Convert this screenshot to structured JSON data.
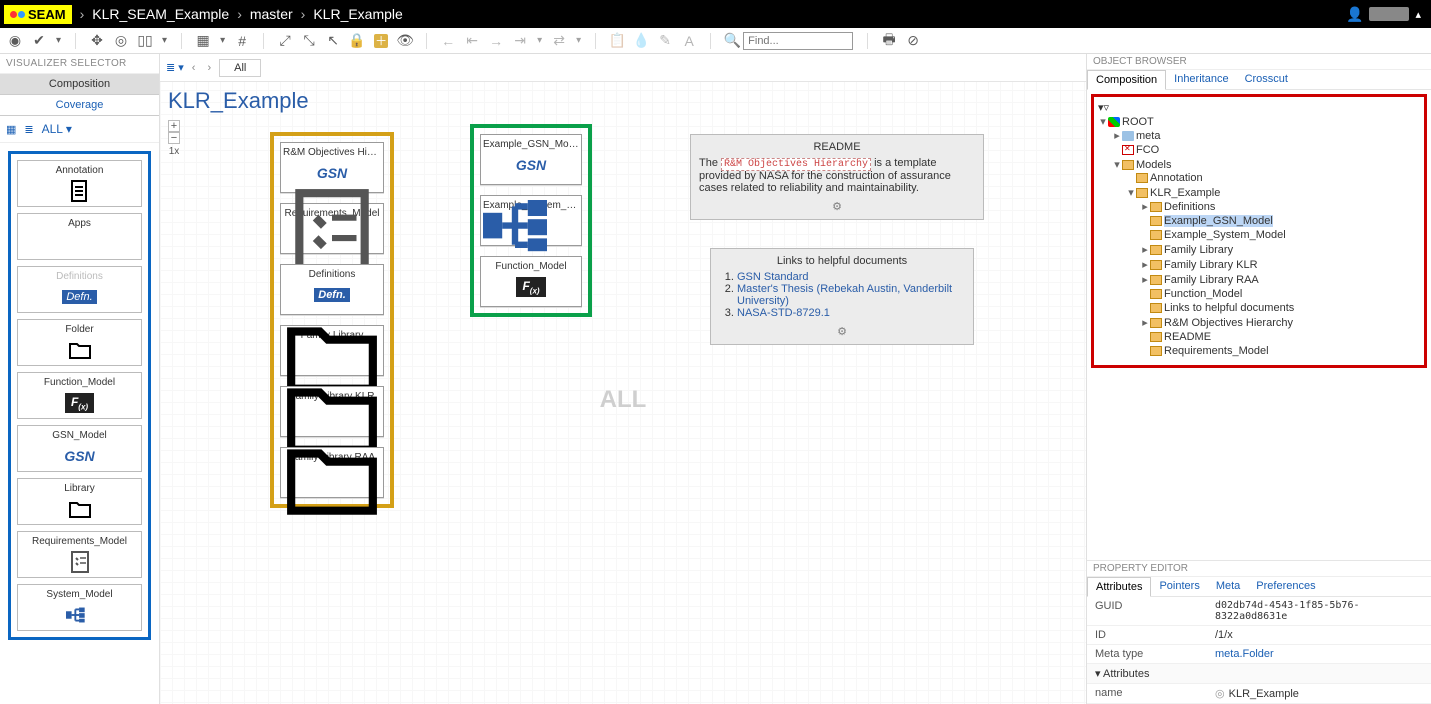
{
  "topbar": {
    "brand": "SEAM",
    "breadcrumb": [
      "KLR_SEAM_Example",
      "master",
      "KLR_Example"
    ]
  },
  "toolbar": {
    "search_placeholder": "Find..."
  },
  "left": {
    "title": "VISUALIZER SELECTOR",
    "tab_composition": "Composition",
    "tab_coverage": "Coverage",
    "all_label": "ALL",
    "palette": [
      {
        "label": "Annotation",
        "kind": "doc"
      },
      {
        "label": "Apps",
        "kind": "none"
      },
      {
        "label": "Definitions",
        "kind": "defn",
        "disabled": true
      },
      {
        "label": "Folder",
        "kind": "folder"
      },
      {
        "label": "Function_Model",
        "kind": "fx"
      },
      {
        "label": "GSN_Model",
        "kind": "gsn"
      },
      {
        "label": "Library",
        "kind": "folder"
      },
      {
        "label": "Requirements_Model",
        "kind": "req"
      },
      {
        "label": "System_Model",
        "kind": "sys"
      }
    ]
  },
  "canvas": {
    "tab_all": "All",
    "title": "KLR_Example",
    "zoom": "1x",
    "watermark": "ALL",
    "yellow_group": [
      {
        "label": "R&M Objectives Hier...",
        "body": "GSN",
        "style": "gsn"
      },
      {
        "label": "Requirements_Model",
        "body": "",
        "style": "req"
      },
      {
        "label": "Definitions",
        "body": "Defn.",
        "style": "defn"
      },
      {
        "label": "Family Library",
        "body": "",
        "style": "folder"
      },
      {
        "label": "Family Library KLR",
        "body": "",
        "style": "folder"
      },
      {
        "label": "Family Library RAA",
        "body": "",
        "style": "folder"
      }
    ],
    "green_group": [
      {
        "label": "Example_GSN_Model",
        "body": "GSN",
        "style": "gsn"
      },
      {
        "label": "Example_System_M...",
        "body": "",
        "style": "sys"
      },
      {
        "label": "Function_Model",
        "body": "F(x)",
        "style": "fx"
      }
    ],
    "readme": {
      "head": "README",
      "pre": "The ",
      "code": "R&M Objectives Hierarchy",
      "post": " is a template provided by NASA for the construction of assurance cases related to reliability and maintainability."
    },
    "links": {
      "head": "Links to helpful documents",
      "items": [
        "GSN Standard",
        "Master's Thesis (Rebekah Austin, Vanderbilt University)",
        "NASA-STD-8729.1"
      ]
    }
  },
  "browser": {
    "title": "OBJECT BROWSER",
    "tabs": [
      "Composition",
      "Inheritance",
      "Crosscut"
    ],
    "tree": {
      "root": "ROOT",
      "meta": "meta",
      "fco": "FCO",
      "models": "Models",
      "annotation": "Annotation",
      "klr": "KLR_Example",
      "children": [
        "Definitions",
        "Example_GSN_Model",
        "Example_System_Model",
        "Family Library",
        "Family Library KLR",
        "Family Library RAA",
        "Function_Model",
        "Links to helpful documents",
        "R&M Objectives Hierarchy",
        "README",
        "Requirements_Model"
      ]
    }
  },
  "props": {
    "title": "PROPERTY EDITOR",
    "tabs": [
      "Attributes",
      "Pointers",
      "Meta",
      "Preferences"
    ],
    "guid_k": "GUID",
    "guid_v": "d02db74d-4543-1f85-5b76-8322a0d8631e",
    "id_k": "ID",
    "id_v": "/1/x",
    "meta_k": "Meta type",
    "meta_v": "meta.Folder",
    "attr_section": "Attributes",
    "name_k": "name",
    "name_v": "KLR_Example"
  }
}
